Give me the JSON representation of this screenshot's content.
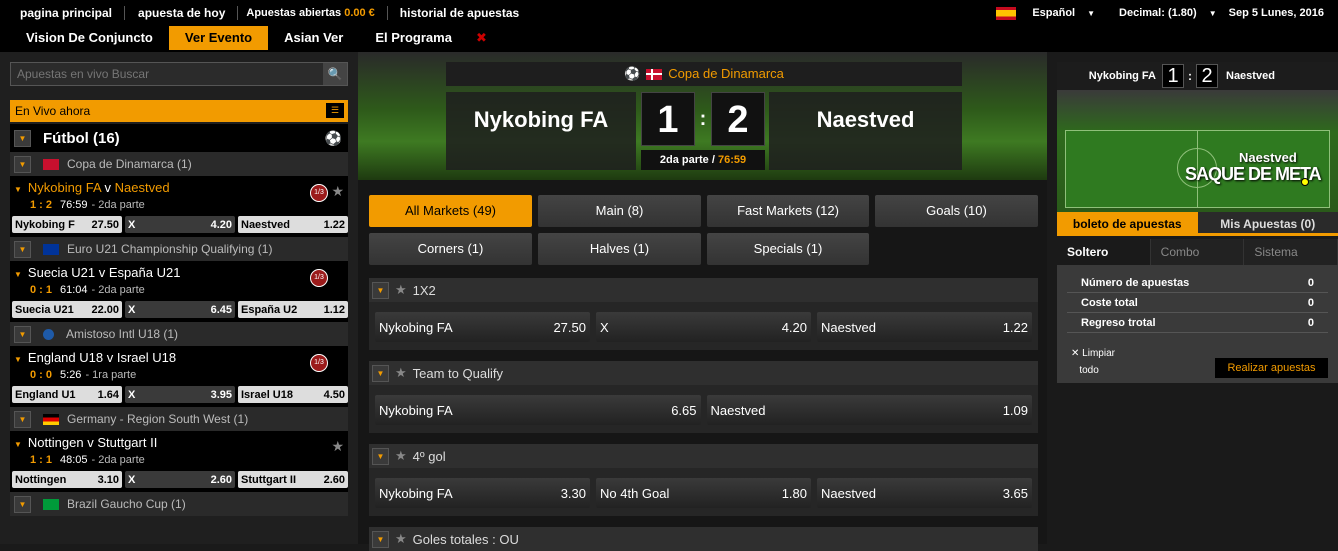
{
  "topbar": {
    "links": [
      "pagina principal",
      "apuesta de hoy",
      "Apuestas abiertas",
      "historial de apuestas"
    ],
    "open_bets_amount": "0.00 €",
    "language": "Español",
    "odds_format": "Decimal: (1.80)",
    "date": "Sep 5 Lunes, 2016"
  },
  "nav": {
    "items": [
      "Vision De Conjuncto",
      "Ver Evento",
      "Asian Ver",
      "El Programa"
    ],
    "active": "Ver Evento"
  },
  "left": {
    "search_placeholder": "Apuestas en vivo Buscar",
    "live_now": "En Vivo ahora",
    "sport": "Fútbol (16)",
    "competitions": [
      {
        "name": "Copa de Dinamarca (1)",
        "flag": "denmark"
      },
      {
        "name": "Euro U21 Championship Qualifying (1)",
        "flag": "eu"
      },
      {
        "name": "Amistoso Intl U18 (1)",
        "flag": "world"
      },
      {
        "name": "Germany - Region South West (1)",
        "flag": "germany"
      },
      {
        "name": "Brazil Gaucho Cup (1)",
        "flag": "brazil"
      }
    ],
    "matches": [
      {
        "home": "Nykobing FA",
        "away": "Naestved",
        "score": "1 : 2",
        "time": "76:59",
        "period": "- 2da parte",
        "odds": [
          [
            "Nykobing F",
            "27.50"
          ],
          [
            "X",
            "4.20"
          ],
          [
            "Naestved",
            "1.22"
          ]
        ]
      },
      {
        "home": "Suecia U21",
        "away": "España U21",
        "score": "0 : 1",
        "time": "61:04",
        "period": "- 2da parte",
        "odds": [
          [
            "Suecia U21",
            "22.00"
          ],
          [
            "X",
            "6.45"
          ],
          [
            "España U2",
            "1.12"
          ]
        ]
      },
      {
        "home": "England U18",
        "away": "Israel U18",
        "score": "0 : 0",
        "time": "5:26",
        "period": "- 1ra parte",
        "odds": [
          [
            "England U1",
            "1.64"
          ],
          [
            "X",
            "3.95"
          ],
          [
            "Israel U18",
            "4.50"
          ]
        ]
      },
      {
        "home": "Nottingen",
        "away": "Stuttgart II",
        "score": "1 : 1",
        "time": "48:05",
        "period": "- 2da parte",
        "odds": [
          [
            "Nottingen",
            "3.10"
          ],
          [
            "X",
            "2.60"
          ],
          [
            "Stuttgart II",
            "2.60"
          ]
        ]
      }
    ],
    "v": "v"
  },
  "event": {
    "competition": "Copa de Dinamarca",
    "home": "Nykobing FA",
    "away": "Naestved",
    "home_score": "1",
    "away_score": "2",
    "period": "2da parte / ",
    "time": "76:59"
  },
  "market_tabs": [
    {
      "label": "All Markets (49)",
      "active": true
    },
    {
      "label": "Main (8)"
    },
    {
      "label": "Fast Markets (12)"
    },
    {
      "label": "Goals (10)"
    },
    {
      "label": "Corners (1)"
    },
    {
      "label": "Halves (1)"
    },
    {
      "label": "Specials (1)"
    }
  ],
  "markets": [
    {
      "title": "1X2",
      "selections": [
        [
          "Nykobing FA",
          "27.50"
        ],
        [
          "X",
          "4.20"
        ],
        [
          "Naestved",
          "1.22"
        ]
      ]
    },
    {
      "title": "Team to Qualify",
      "selections": [
        [
          "Nykobing FA",
          "6.65"
        ],
        [
          "Naestved",
          "1.09"
        ]
      ]
    },
    {
      "title": "4º gol",
      "selections": [
        [
          "Nykobing FA",
          "3.30"
        ],
        [
          "No 4th Goal",
          "1.80"
        ],
        [
          "Naestved",
          "3.65"
        ]
      ]
    },
    {
      "title": "Goles totales : OU",
      "selections": []
    }
  ],
  "right": {
    "mini_home": "Nykobing FA",
    "mini_away": "Naestved",
    "mini_home_score": "1",
    "mini_away_score": "2",
    "pitch_team": "Naestved",
    "pitch_event": "SAQUE DE META",
    "slip_tab_1": "boleto de apuestas",
    "slip_tab_2": "Mis Apuestas (0)",
    "sub_tabs": [
      "Soltero",
      "Combo",
      "Sistema"
    ],
    "rows": [
      [
        "Número de apuestas",
        "0"
      ],
      [
        "Coste total",
        "0"
      ],
      [
        "Regreso trotal",
        "0"
      ]
    ],
    "clear_label": "Limpiar",
    "clear_label_2": "todo",
    "place_bet": "Realizar apuestas"
  },
  "colors": {
    "accent": "#f29b00",
    "background": "#1a1a1a"
  }
}
